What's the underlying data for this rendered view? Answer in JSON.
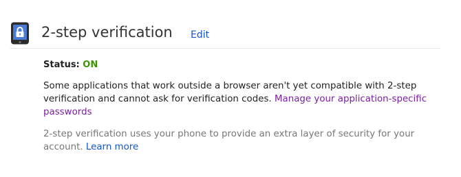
{
  "section": {
    "icon": "phone-lock-icon",
    "title": "2-step verification",
    "edit_label": "Edit"
  },
  "status": {
    "label": "Status:",
    "value": "ON",
    "value_color": "#3d9400"
  },
  "compat_notice": {
    "text": "Some applications that work outside a browser aren't yet compatible with 2-step verification and cannot ask for verification codes.",
    "link_label": "Manage your application-specific passwords"
  },
  "info": {
    "text": "2-step verification uses your phone to provide an extra layer of security for your account.",
    "link_label": "Learn more"
  },
  "colors": {
    "link": "#1155cc",
    "visited_link": "#7b1fa2",
    "muted_text": "#777777"
  }
}
